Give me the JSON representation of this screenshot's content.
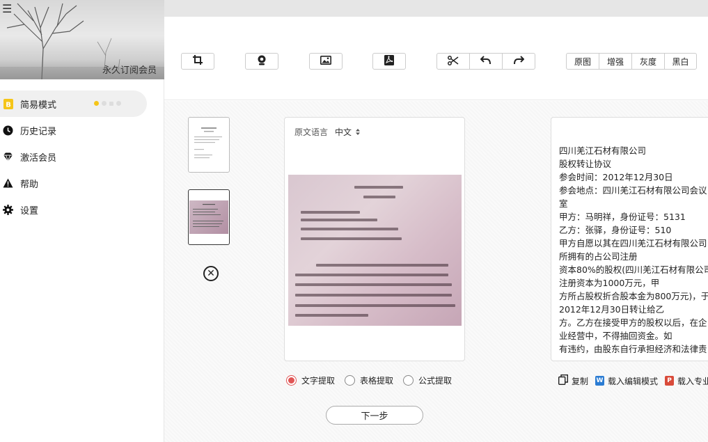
{
  "sidebar": {
    "vip_label": "永久订阅会员",
    "items": [
      {
        "label": "简易模式",
        "icon": "mode-icon",
        "active": true
      },
      {
        "label": "历史记录",
        "icon": "clock-icon"
      },
      {
        "label": "激活会员",
        "icon": "diamond-icon"
      },
      {
        "label": "帮助",
        "icon": "warning-icon"
      },
      {
        "label": "设置",
        "icon": "gear-icon"
      }
    ]
  },
  "toolbar": {
    "icons": [
      "crop-icon",
      "camera-icon",
      "image-icon",
      "pdf-icon",
      "scissors-icon",
      "undo-icon",
      "redo-icon"
    ],
    "filters": [
      "原图",
      "增强",
      "灰度",
      "黑白"
    ]
  },
  "source": {
    "lang_label": "原文语言",
    "lang_value": "中文"
  },
  "result": {
    "lines": [
      "四川羌江石材有限公司",
      "股权转让协议",
      "参会时间：2012年12月30日",
      "参会地点：四川羌江石材有限公司会议",
      "室",
      "甲方：马明祥，身份证号：5131",
      "乙方：张驿，身份证号：510",
      "甲方自愿以其在四川羌江石材有限公司",
      "所拥有的占公司注册",
      "资本80%的股权(四川羌江石材有限公司",
      "注册资本为1000万元，甲",
      "方所占股权折合股本金为800万元)，于",
      "2012年12月30日转让给乙",
      "方。乙方在接受甲方的股权以后，在企",
      "业经营中，不得抽回资金。如",
      "有违约，由股东自行承担经济和法律责"
    ]
  },
  "extract_modes": {
    "options": [
      "文字提取",
      "表格提取",
      "公式提取"
    ],
    "selected": "文字提取"
  },
  "actions": {
    "copy": "复制",
    "load_edit": "载入编辑模式",
    "load_pro": "载入专业"
  },
  "next_button": "下一步",
  "colors": {
    "accent": "#e05555",
    "active_dot": "#f5c518",
    "word_badge": "#2b7cd3",
    "ppt_badge": "#d94b3a"
  }
}
